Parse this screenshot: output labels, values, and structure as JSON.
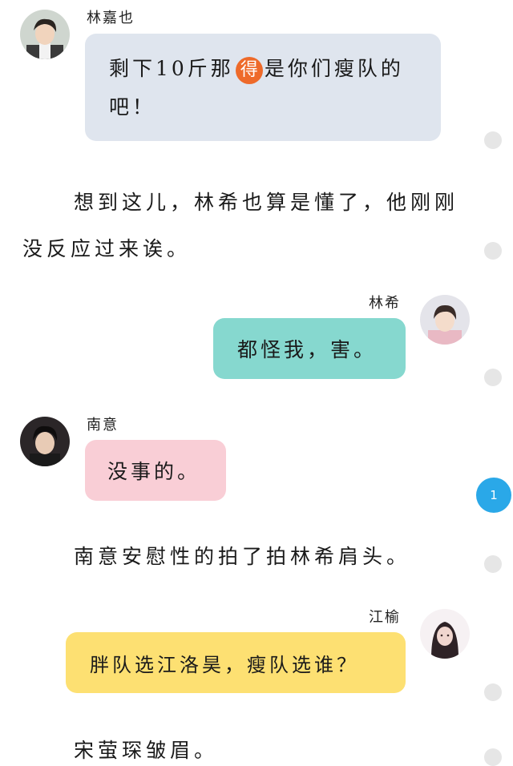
{
  "messages": [
    {
      "sender": "林嘉也",
      "before": "剩下10斤那",
      "mark": "得",
      "after": "是你们瘦队的吧！"
    },
    {
      "sender": "林希",
      "text": "都怪我，害。"
    },
    {
      "sender": "南意",
      "text": "没事的。"
    },
    {
      "sender": "江榆",
      "text": "胖队选江洛昊，瘦队选谁？"
    }
  ],
  "narration": [
    {
      "line1": "想到这儿，林希也算是懂了，他刚刚",
      "line2": "没反应过来诶。"
    },
    {
      "text": "南意安慰性的拍了拍林希肩头。"
    },
    {
      "text": "宋萤琛皱眉。"
    }
  ],
  "badge": {
    "count": "1"
  },
  "colors": {
    "bubble_gray": "#dfe5ee",
    "bubble_teal": "#86d8cf",
    "bubble_pink": "#f9ced6",
    "bubble_yellow": "#fde072",
    "badge_blue": "#2aa8e8",
    "mark_orange": "#ee6a2a"
  }
}
